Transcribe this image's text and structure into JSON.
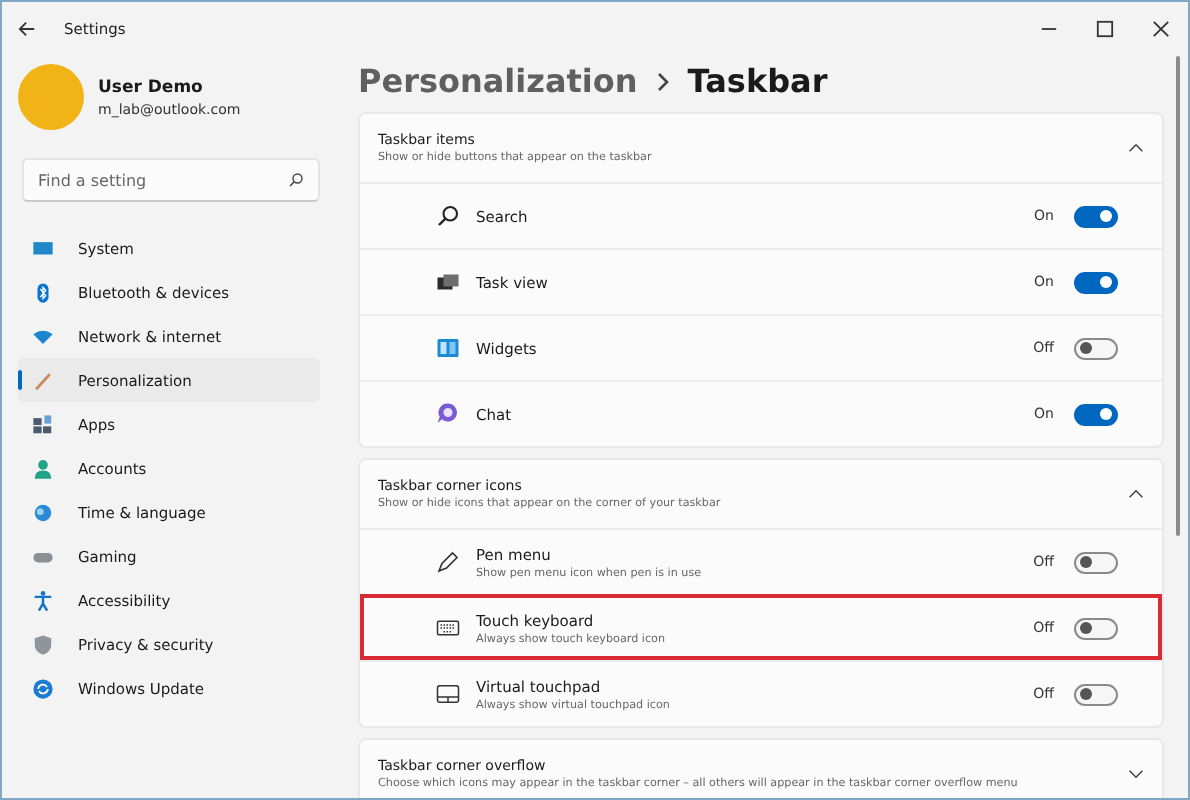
{
  "window": {
    "title": "Settings"
  },
  "user": {
    "name": "User Demo",
    "email": "m_lab@outlook.com"
  },
  "search": {
    "placeholder": "Find a setting"
  },
  "nav": [
    {
      "label": "System",
      "selected": false
    },
    {
      "label": "Bluetooth & devices",
      "selected": false
    },
    {
      "label": "Network & internet",
      "selected": false
    },
    {
      "label": "Personalization",
      "selected": true
    },
    {
      "label": "Apps",
      "selected": false
    },
    {
      "label": "Accounts",
      "selected": false
    },
    {
      "label": "Time & language",
      "selected": false
    },
    {
      "label": "Gaming",
      "selected": false
    },
    {
      "label": "Accessibility",
      "selected": false
    },
    {
      "label": "Privacy & security",
      "selected": false
    },
    {
      "label": "Windows Update",
      "selected": false
    }
  ],
  "breadcrumb": [
    "Personalization",
    "Taskbar"
  ],
  "sections": [
    {
      "title": "Taskbar items",
      "subtitle": "Show or hide buttons that appear on the taskbar",
      "expanded": true,
      "items": [
        {
          "label": "Search",
          "state": "On",
          "on": true,
          "highlighted": false
        },
        {
          "label": "Task view",
          "state": "On",
          "on": true,
          "highlighted": false
        },
        {
          "label": "Widgets",
          "state": "Off",
          "on": false,
          "highlighted": false
        },
        {
          "label": "Chat",
          "state": "On",
          "on": true,
          "highlighted": false
        }
      ]
    },
    {
      "title": "Taskbar corner icons",
      "subtitle": "Show or hide icons that appear on the corner of your taskbar",
      "expanded": true,
      "items": [
        {
          "label": "Pen menu",
          "description": "Show pen menu icon when pen is in use",
          "state": "Off",
          "on": false,
          "highlighted": false
        },
        {
          "label": "Touch keyboard",
          "description": "Always show touch keyboard icon",
          "state": "Off",
          "on": false,
          "highlighted": true
        },
        {
          "label": "Virtual touchpad",
          "description": "Always show virtual touchpad icon",
          "state": "Off",
          "on": false,
          "highlighted": false
        }
      ]
    },
    {
      "title": "Taskbar corner overflow",
      "subtitle": "Choose which icons may appear in the taskbar corner – all others will appear in the taskbar corner overflow menu",
      "expanded": false
    }
  ]
}
